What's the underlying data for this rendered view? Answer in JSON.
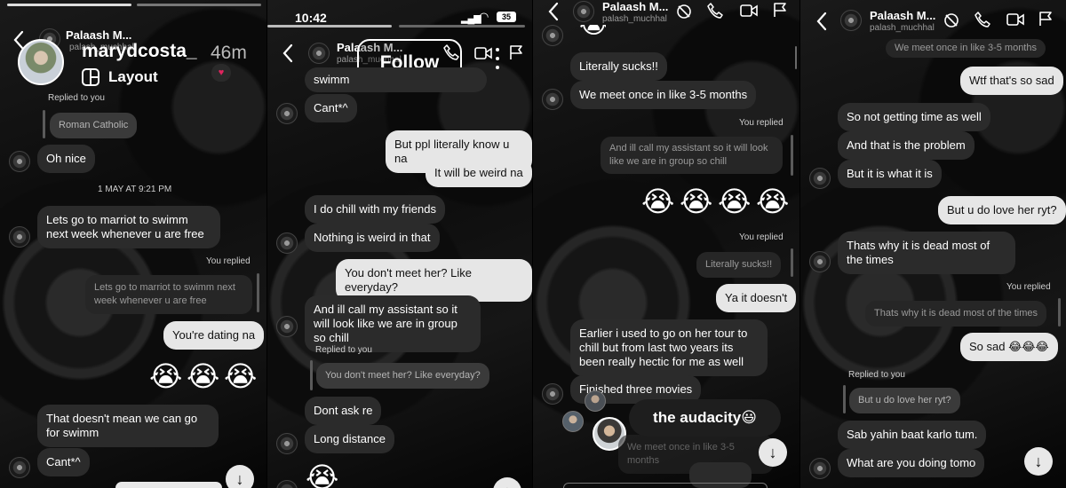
{
  "story": {
    "username": "marydcosta_",
    "time_ago": "46m",
    "layout_label": "Layout",
    "follow_label": "Follow"
  },
  "status_bar": {
    "time": "10:42",
    "battery": "35"
  },
  "chat_header": {
    "name": "Palaash M...",
    "handle": "palash_muchhal"
  },
  "labels": {
    "replied_to_you": "Replied to you",
    "you_replied": "You replied",
    "timestamp": "1 MAY AT 9:21 PM"
  },
  "panel1": {
    "quote_roman": "Roman Catholic",
    "msg_oh_nice": "Oh nice",
    "msg_marriot": "Lets go to marriot to swimm next week whenever u are free",
    "quote_marriot": "Lets go to marriot to swimm next week whenever u are free",
    "msg_dating": "You're dating na",
    "emoji_cry": "😭",
    "msg_doesnt_mean": "That doesn't mean we can go for swimm",
    "msg_cant": "Cant*^"
  },
  "panel2": {
    "msg_swimm": "swimm",
    "msg_cant": "Cant*^",
    "msg_ppl_know": "But ppl literally know u na",
    "msg_weird": "It will be weird na",
    "msg_chill": "I do chill with my friends",
    "msg_nothing_weird": "Nothing is weird in that",
    "msg_dont_meet": "You don't meet her? Like everyday?",
    "msg_assistant": "And ill call my assistant so it will look like we are in group so chill",
    "quote_dont_meet": "You don't meet her? Like everyday?",
    "msg_dont_ask": "Dont ask re",
    "msg_long_distance": "Long distance",
    "emoji_cry": "😭"
  },
  "panel3": {
    "msg_sucks": "Literally sucks!!",
    "msg_meet": "We meet  once in like 3-5 months",
    "quote_assistant": "And ill call my assistant so it will look like we are in group so chill",
    "emoji_cry": "😭",
    "quote_sucks": "Literally sucks!!",
    "msg_ya": "Ya it doesn't",
    "msg_tour": "Earlier i used to go on her tour to chill but from last two years its been really hectic for me as well",
    "msg_movies": "Finished three movies",
    "sticker_audacity": "the audacity😃",
    "quote_meet_partial": "We meet  once in like 3-5 months"
  },
  "panel4": {
    "quote_meet_top": "We meet  once in like 3-5 months",
    "msg_wtf": "Wtf that's so sad",
    "msg_no_time": "So not getting time as well",
    "msg_problem": "And that is the problem",
    "msg_what_it_is": "But it is what it is",
    "msg_love_her": "But u do love her ryt?",
    "msg_dead": "Thats why it is dead most of the times",
    "quote_dead": "Thats why it is dead most of the times",
    "msg_so_sad": "So sad 😂😂😂",
    "quote_love_her": "But u do love her ryt?",
    "msg_baat": "Sab yahin baat karlo tum.",
    "msg_tomo": "What are you doing tomo"
  },
  "icons": {
    "back": "back-chevron-icon",
    "mute": "mute-icon",
    "phone": "phone-icon",
    "video": "video-camera-icon",
    "flag": "flag-icon",
    "scroll_down": "arrow-down-icon"
  },
  "colors": {
    "incoming_bubble": "#2b2b2b",
    "outgoing_bubble": "#e6e6e6",
    "quote_bubble": "#3a3a3a",
    "background": "#0c0c0c"
  }
}
